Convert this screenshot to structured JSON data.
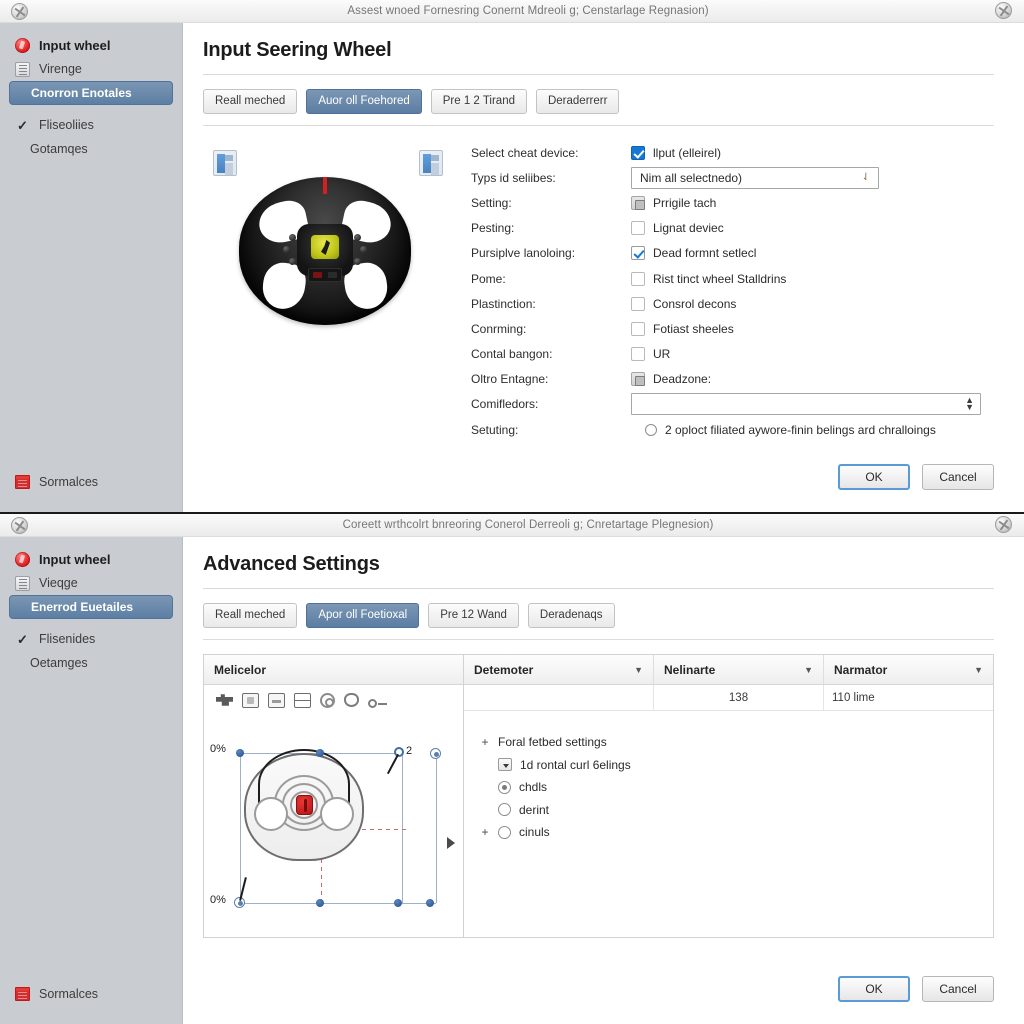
{
  "window_top": {
    "titlebar": {
      "title": "Assest wnoed Fornesring Conernt Mdreoli g; Censtarlage Regnasion)"
    },
    "sidebar": {
      "items": [
        {
          "label": "Input wheel",
          "icon": "record-icon"
        },
        {
          "label": "Virenge",
          "icon": "tile-icon"
        },
        {
          "label": "Cnorron Enotales",
          "icon": "none"
        },
        {
          "label": "Fliseoliies",
          "icon": "check-icon"
        },
        {
          "label": "Gotamqes",
          "icon": "none"
        }
      ],
      "bottom_item": {
        "label": "Sormalces",
        "icon": "clipboard-icon"
      }
    },
    "page_title": "Input Seering Wheel",
    "tabs": [
      {
        "label": "Reall meched",
        "active": false
      },
      {
        "label": "Auor oll Foehored",
        "active": true
      },
      {
        "label": "Pre 1 2 Tirand",
        "active": false
      },
      {
        "label": "Deraderrerr",
        "active": false
      }
    ],
    "preview": {
      "thumb_left": "image-thumbnail-icon",
      "thumb_right": "document-thumbnail-icon",
      "photo": "steering-wheel-photo"
    },
    "form_rows": [
      {
        "label": "Select cheat device:",
        "control": "checkbox",
        "checked": true,
        "text": "llput (elleirel)"
      },
      {
        "label": "Typs id seliibes:",
        "control": "textbox",
        "value": "Nim all selectnedo)",
        "hint": "caret"
      },
      {
        "label": "Setting:",
        "control": "iconbox",
        "text": "Prrigile tach"
      },
      {
        "label": "Pesting:",
        "control": "checkbox",
        "checked": false,
        "text": "Lignat deviec"
      },
      {
        "label": "Pursiplve lanoloing:",
        "control": "checkbox-tick",
        "checked": true,
        "text": "Dead formnt setlecl"
      },
      {
        "label": "Pome:",
        "control": "checkbox",
        "checked": false,
        "text": "Rist tinct wheel Stalldrins"
      },
      {
        "label": "Plastinction:",
        "control": "checkbox",
        "checked": false,
        "text": "Consrol decons"
      },
      {
        "label": "Conrming:",
        "control": "checkbox",
        "checked": false,
        "text": "Fotiast sheeles"
      },
      {
        "label": "Contal bangon:",
        "control": "checkbox",
        "checked": false,
        "text": "UR"
      },
      {
        "label": "Oltro Entagne:",
        "control": "iconbox",
        "text": "Deadzone:"
      },
      {
        "label": "Comifledors:",
        "control": "spinbox",
        "value": ""
      },
      {
        "label": "Setuting:",
        "control": "radio",
        "text": "2 oploct filiated aywore-finin belings ard chralloings"
      }
    ],
    "ok_label": "OK",
    "cancel_label": "Cancel"
  },
  "window_bottom": {
    "titlebar": {
      "title": "Coreett wrthcolrt bnreoring Conerol Derreoli g; Cnretartage Plegnesion)"
    },
    "sidebar": {
      "items": [
        {
          "label": "Input wheel",
          "icon": "record-icon"
        },
        {
          "label": "Vieqge",
          "icon": "tile-icon"
        },
        {
          "label": "Enerrod Euetailes",
          "icon": "none"
        },
        {
          "label": "Flisenides",
          "icon": "check-icon"
        },
        {
          "label": "Oetamges",
          "icon": "none"
        }
      ],
      "bottom_item": {
        "label": "Sormalces",
        "icon": "clipboard-icon"
      }
    },
    "page_title": "Advanced Settings",
    "tabs": [
      {
        "label": "Reall meched",
        "active": false
      },
      {
        "label": "Apor oll Foetioxal",
        "active": true
      },
      {
        "label": "Pre 12 Wand",
        "active": false
      },
      {
        "label": "Deradenaqs",
        "active": false
      }
    ],
    "editor_header": "Melicelor",
    "table_headers": [
      {
        "label": "Detemoter"
      },
      {
        "label": "Nelinarte"
      },
      {
        "label": "Narmator"
      }
    ],
    "table_row": [
      "",
      "138",
      "110 lime"
    ],
    "canvas": {
      "label_top_left": "0%",
      "label_bottom_left": "0%",
      "label_handle": "2",
      "toolbar_icons": [
        "puzzle-icon",
        "lock-icon",
        "equals-icon",
        "split-pane-icon",
        "gear-icon",
        "hand-icon",
        "key-icon"
      ]
    },
    "tree": [
      {
        "indent": 0,
        "expander": "+",
        "control": "none",
        "label": "Foral fetbed settings"
      },
      {
        "indent": 1,
        "expander": "",
        "control": "dropdown",
        "label": "1d rontal curl 6elings"
      },
      {
        "indent": 1,
        "expander": "",
        "control": "radio-selected",
        "label": "chdls"
      },
      {
        "indent": 1,
        "expander": "",
        "control": "radio",
        "label": "derint"
      },
      {
        "indent": 0,
        "expander": "+",
        "control": "radio",
        "label": "cinuls"
      }
    ],
    "ok_label": "OK",
    "cancel_label": "Cancel"
  },
  "colors": {
    "sidebar_bg": "#c9ccd1",
    "selected_blue": "#5c7fa3",
    "checkbox_blue": "#1578d4",
    "accent_red": "#e02020",
    "title_text": "#767676"
  }
}
